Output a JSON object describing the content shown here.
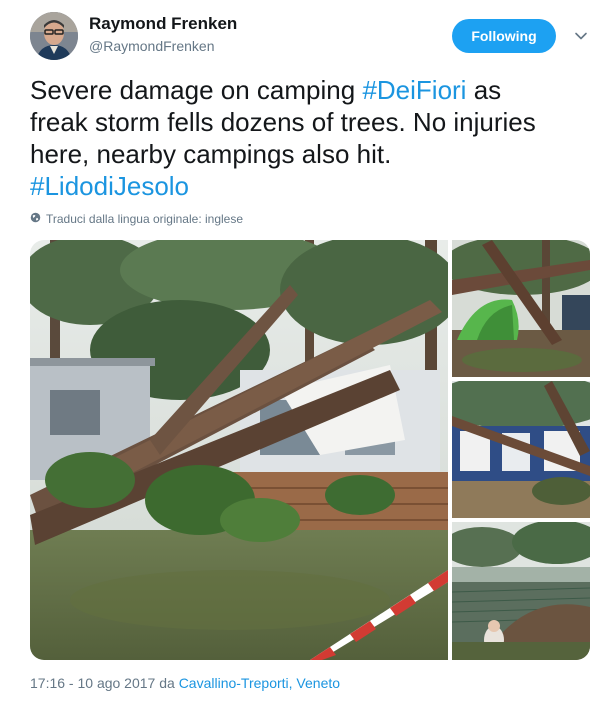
{
  "author": {
    "name": "Raymond Frenken",
    "handle": "@RaymondFrenken"
  },
  "follow_button": {
    "label": "Following",
    "color": "#1da1f2"
  },
  "menu": {
    "icon": "chevron-down-icon"
  },
  "tweet": {
    "line1_text": "Severe damage on camping ",
    "line1_hashtag": "#DeiFiori",
    "line1_tail": " as",
    "line2": "freak storm fells dozens of trees. No injuries",
    "line3": "here, nearby campings also hit.",
    "line4_hashtag": "#LidodiJesolo",
    "hashtag_color": "#1b95e0"
  },
  "translate": {
    "icon": "globe-icon",
    "label": "Traduci dalla lingua originale: inglese"
  },
  "media": {
    "photos": [
      {
        "alt": "fallen-pine-trees-on-mobile-home"
      },
      {
        "alt": "fallen-tree-on-tent"
      },
      {
        "alt": "fallen-tree-on-caravan-awning"
      },
      {
        "alt": "damaged-campsite-fence"
      }
    ]
  },
  "meta": {
    "timestamp": "17:16 - 10 ago 2017 da ",
    "place": "Cavallino-Treporti, Veneto"
  }
}
